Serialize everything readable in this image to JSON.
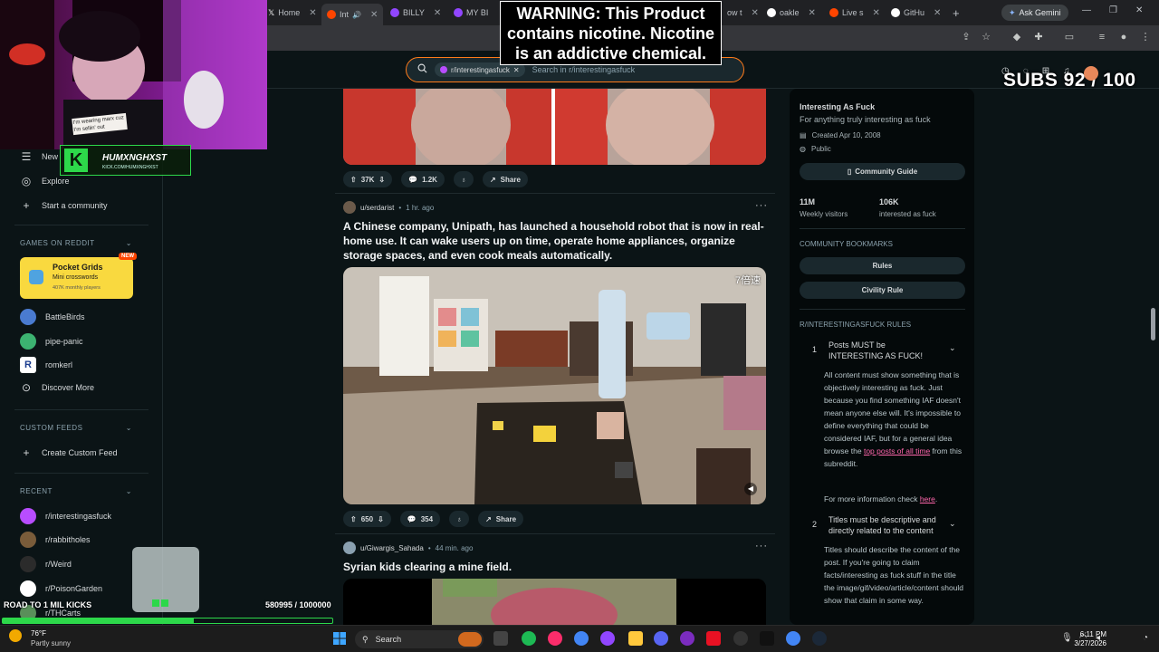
{
  "browser": {
    "tabs": [
      {
        "label": "Home",
        "color": "#ffffff"
      },
      {
        "label": "Int",
        "color": "#ff4500"
      },
      {
        "label": "BILLY",
        "color": "#9146ff"
      },
      {
        "label": "MY BI",
        "color": "#9146ff"
      },
      {
        "label": "oakle",
        "color": "#ffffff"
      },
      {
        "label": "Live s",
        "color": "#ff4500"
      },
      {
        "label": "GitHu",
        "color": "#ffffff"
      }
    ],
    "hidden_tab_fragment": "ow t",
    "new_tab": "+",
    "ask_gemini": "Ask Gemini"
  },
  "search": {
    "chip": "r/interestingasfuck",
    "placeholder": "Search in r/interestingasfuck"
  },
  "sidebar": {
    "nav": [
      {
        "label": "New",
        "icon": "new-icon"
      },
      {
        "label": "Explore",
        "icon": "explore-icon"
      },
      {
        "label": "Start a community",
        "icon": "plus-icon"
      }
    ],
    "games_header": "GAMES ON REDDIT",
    "featured_game": {
      "title": "Pocket Grids",
      "subtitle": "Mini crosswords",
      "meta": "407K monthly players",
      "badge": "NEW"
    },
    "games": [
      "BattleBirds",
      "pipe-panic",
      "romkerl",
      "Discover More"
    ],
    "custom_feeds_header": "CUSTOM FEEDS",
    "create_feed": "Create Custom Feed",
    "recent_header": "RECENT",
    "recent": [
      "r/interestingasfuck",
      "r/rabbitholes",
      "r/Weird",
      "r/PoisonGarden",
      "r/THCarts"
    ]
  },
  "feed": {
    "post0": {
      "upvotes": "37K",
      "comments": "1.2K",
      "share": "Share"
    },
    "post1": {
      "author": "u/serdarist",
      "time": "1 hr. ago",
      "title": "A Chinese company, Unipath, has launched a household robot that is now in real-home use. It can wake users up on time, operate home appliances, organize storage spaces, and even cook meals automatically.",
      "video_badge": "7倍速",
      "upvotes": "650",
      "comments": "354",
      "share": "Share"
    },
    "post2": {
      "author": "u/Giwargis_Sahada",
      "time": "44 min. ago",
      "title": "Syrian kids clearing a mine field."
    }
  },
  "community": {
    "name": "Interesting As Fuck",
    "description": "For anything truly interesting as fuck",
    "created": "Created Apr 10, 2008",
    "visibility": "Public",
    "guide_button": "Community Guide",
    "weekly_visitors": "11M",
    "weekly_visitors_label": "Weekly visitors",
    "interested": "106K",
    "interested_label": "interested as fuck",
    "bookmarks_header": "COMMUNITY BOOKMARKS",
    "bookmarks": [
      "Rules",
      "Civility Rule"
    ],
    "rules_header": "R/INTERESTINGASFUCK RULES",
    "rule1": {
      "num": "1",
      "title": "Posts MUST be INTERESTING AS FUCK!",
      "body_a": "All content must show something that is objectively interesting as fuck. Just because you find something IAF doesn't mean anyone else will. It's impossible to define everything that could be considered IAF, but for a general idea browse the ",
      "link": "top posts of all time",
      "body_b": " from this subreddit.",
      "more_a": "For more information check ",
      "more_link": "here",
      "more_b": "."
    },
    "rule2": {
      "num": "2",
      "title": "Titles must be descriptive and directly related to the content",
      "body": "Titles should describe the content of the post. If you're going to claim facts/interesting as fuck stuff in the title the image/gif/video/article/content should show that claim in some way."
    }
  },
  "overlay": {
    "warning": "WARNING: This Product contains nicotine. Nicotine is an addictive chemical.",
    "subs": "SUBS 92 / 100",
    "road_label": "ROAD TO 1 MIL KICKS",
    "road_count": "580995 / 1000000",
    "road_progress": 0.581,
    "kick_name": "HUMXNGHXST",
    "kick_url": "KICK.COM/HUMXNGHXST",
    "webcam_sign": "I'm wearing marx cuz I'm sellin' out"
  },
  "taskbar": {
    "weather_temp": "76°F",
    "weather_desc": "Partly sunny",
    "search": "Search",
    "time": "6:11 PM",
    "date": "3/27/2026"
  }
}
